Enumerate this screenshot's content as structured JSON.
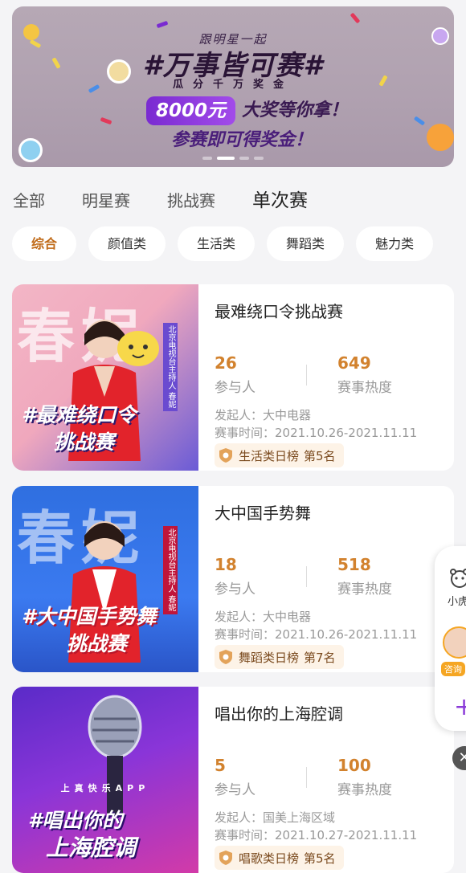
{
  "banner": {
    "tagline": "跟明星一起",
    "title": "#万事皆可赛#",
    "subtitle": "瓜分千万奖金",
    "prize_amount": "8000元",
    "prize_text": "大奖等你拿！",
    "prize_sub": "参赛即可得奖金！",
    "page_count": 4,
    "active_page": 2
  },
  "tabs": [
    {
      "label": "全部",
      "active": false
    },
    {
      "label": "明星赛",
      "active": false
    },
    {
      "label": "挑战赛",
      "active": false
    },
    {
      "label": "单次赛",
      "active": true
    }
  ],
  "chips": [
    {
      "label": "综合",
      "active": true
    },
    {
      "label": "颜值类",
      "active": false
    },
    {
      "label": "生活类",
      "active": false
    },
    {
      "label": "舞蹈类",
      "active": false
    },
    {
      "label": "魅力类",
      "active": false
    }
  ],
  "participants_label": "参与人",
  "heat_label": "赛事热度",
  "cards": [
    {
      "title": "最难绕口令挑战赛",
      "participants": "26",
      "heat": "649",
      "initiator": "发起人：大中电器",
      "time": "赛事时间：2021.10.26-2021.11.11",
      "rank": "生活类日榜",
      "rank_pos": "第5名",
      "thumb_big": "春妮",
      "thumb_caption_1": "#最难绕口令",
      "thumb_caption_2": "挑战赛",
      "thumb_side": "北京电视台主持人 春妮"
    },
    {
      "title": "大中国手势舞",
      "participants": "18",
      "heat": "518",
      "initiator": "发起人：大中电器",
      "time": "赛事时间：2021.10.26-2021.11.11",
      "rank": "舞蹈类日榜",
      "rank_pos": "第7名",
      "thumb_big": "春妮",
      "thumb_caption_1": "#大中国手势舞",
      "thumb_caption_2": "挑战赛",
      "thumb_side": "北京电视台主持人 春妮"
    },
    {
      "title": "唱出你的上海腔调",
      "participants": "5",
      "heat": "100",
      "initiator": "发起人：国美上海区域",
      "time": "赛事时间：2021.10.27-2021.11.11",
      "rank": "唱歌类日榜",
      "rank_pos": "第5名",
      "thumb_big": "",
      "thumb_caption_1": "#唱出你的",
      "thumb_caption_2": "上海腔调",
      "thumb_side": "上真快乐APP"
    }
  ],
  "float_widget": {
    "label_1": "小虎",
    "label_2": "咨询"
  },
  "colors": {
    "accent": "#d2822e",
    "chip_active": "#c06a18",
    "banner_purple": "#7a2bd1"
  }
}
